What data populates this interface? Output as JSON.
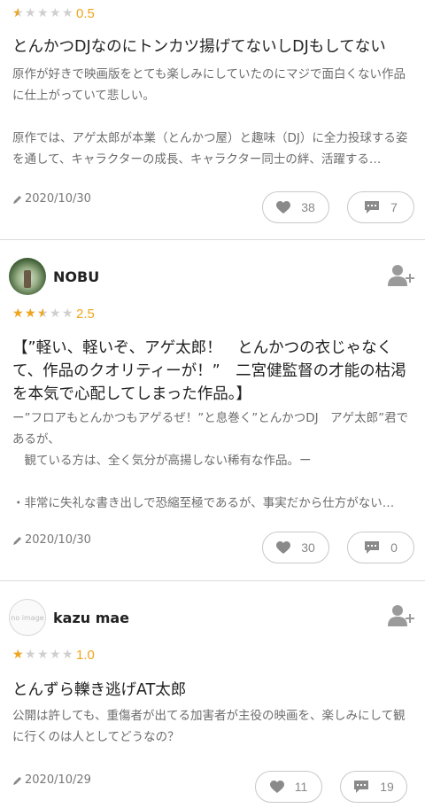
{
  "reviews": [
    {
      "rating": 0.5,
      "score_label": "0.5",
      "title": "とんかつDJなのにトンカツ揚げてないしDJもしてない",
      "body": "原作が好きで映画版をとても楽しみにしていたのにマジで面白くない作品に仕上がっていて悲しい。\n\n原作では、アゲ太郎が本業（とんかつ屋）と趣味（DJ）に全力投球する姿を通して、キャラクターの成長、キャラクター同士の絆、活躍する…",
      "date": "2020/10/30",
      "likes": "38",
      "comments": "7"
    },
    {
      "user": "NOBU",
      "avatar": "forest-photo",
      "rating": 2.5,
      "score_label": "2.5",
      "title": "【”軽い、軽いぞ、アゲ太郎！　とんかつの衣じゃなくて、作品のクオリティーが！”　二宮健監督の才能の枯渇を本気で心配してしまった作品。】",
      "body": "ー”フロアもとんかつもアゲるぜ！”と息巻く”とんかつDJ　アゲ太郎”君であるが、\n　観ている方は、全く気分が高揚しない稀有な作品。ー\n\n・非常に失礼な書き出しで恐縮至極であるが、事実だから仕方がない…",
      "date": "2020/10/30",
      "likes": "30",
      "comments": "0"
    },
    {
      "user": "kazu mae",
      "avatar": "no-image",
      "avatar_text": "no image",
      "rating": 1.0,
      "score_label": "1.0",
      "title": "とんずら轢き逃げAT太郎",
      "body": "公開は許しても、重傷者が出てる加害者が主役の映画を、楽しみにして観に行くのは人としてどうなの？",
      "date": "2020/10/29",
      "likes": "11",
      "comments": "19"
    }
  ],
  "icons": {
    "follow": "add-user-icon",
    "like": "heart-icon",
    "comment": "comment-icon",
    "date": "pencil-icon"
  },
  "colors": {
    "star": "#f0a51a",
    "star_empty": "#cfcfcf",
    "text_muted": "#6c6c6c"
  }
}
